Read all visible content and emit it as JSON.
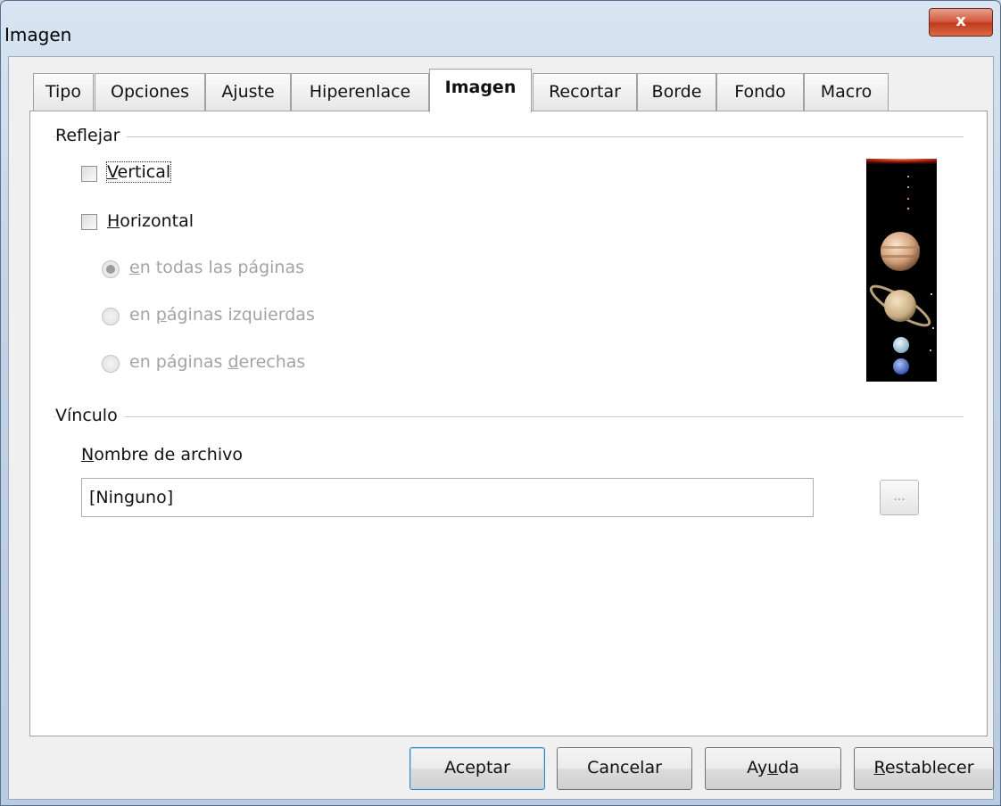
{
  "window": {
    "title": "Imagen",
    "close_label": "x"
  },
  "tabs": [
    {
      "label": "Tipo"
    },
    {
      "label": "Opciones"
    },
    {
      "label": "Ajuste"
    },
    {
      "label": "Hiperenlace"
    },
    {
      "label": "Imagen",
      "active": true
    },
    {
      "label": "Recortar"
    },
    {
      "label": "Borde"
    },
    {
      "label": "Fondo"
    },
    {
      "label": "Macro"
    }
  ],
  "reflejar": {
    "section_label": "Reflejar",
    "vertical": {
      "mnemonic": "V",
      "rest": "ertical",
      "checked": false
    },
    "horizontal": {
      "mnemonic": "H",
      "rest": "orizontal",
      "checked": false
    },
    "options": [
      {
        "pre": "",
        "mnemonic": "e",
        "post": "n todas las páginas",
        "selected": true
      },
      {
        "pre": "en ",
        "mnemonic": "p",
        "post": "áginas izquierdas",
        "selected": false
      },
      {
        "pre": "en páginas ",
        "mnemonic": "d",
        "post": "erechas",
        "selected": false
      }
    ]
  },
  "vinculo": {
    "section_label": "Vínculo",
    "filename_label_mnemonic": "N",
    "filename_label_rest": "ombre de archivo",
    "filename_value": "[Ninguno]",
    "browse_label": "..."
  },
  "buttons": {
    "ok": "Aceptar",
    "cancel": "Cancelar",
    "help_pre": "Ay",
    "help_mnemonic": "u",
    "help_post": "da",
    "reset_mnemonic": "R",
    "reset_rest": "establecer"
  }
}
